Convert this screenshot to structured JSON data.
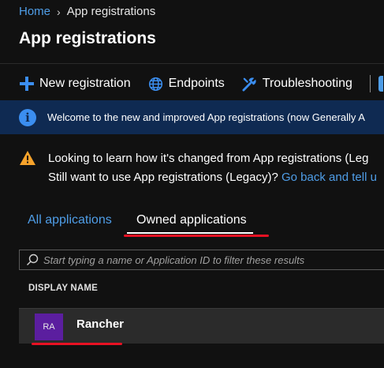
{
  "breadcrumb": {
    "home": "Home",
    "separator": "›",
    "current": "App registrations"
  },
  "page": {
    "title": "App registrations"
  },
  "toolbar": {
    "new_registration": "New registration",
    "endpoints": "Endpoints",
    "troubleshooting": "Troubleshooting"
  },
  "info_banner": {
    "text": "Welcome to the new and improved App registrations (now Generally A"
  },
  "warning": {
    "line1": "Looking to learn how it's changed from App registrations (Leg",
    "line2": "Still want to use App registrations (Legacy)? ",
    "link": "Go back and tell u"
  },
  "tabs": {
    "all": "All applications",
    "owned": "Owned applications"
  },
  "search": {
    "placeholder": "Start typing a name or Application ID to filter these results"
  },
  "table": {
    "column_header": "DISPLAY NAME",
    "rows": [
      {
        "initials": "RA",
        "name": "Rancher"
      }
    ]
  },
  "colors": {
    "accent": "#4f9ee8",
    "highlight": "#e81123",
    "avatar": "#5b1e9f",
    "banner": "#0f2a52"
  }
}
